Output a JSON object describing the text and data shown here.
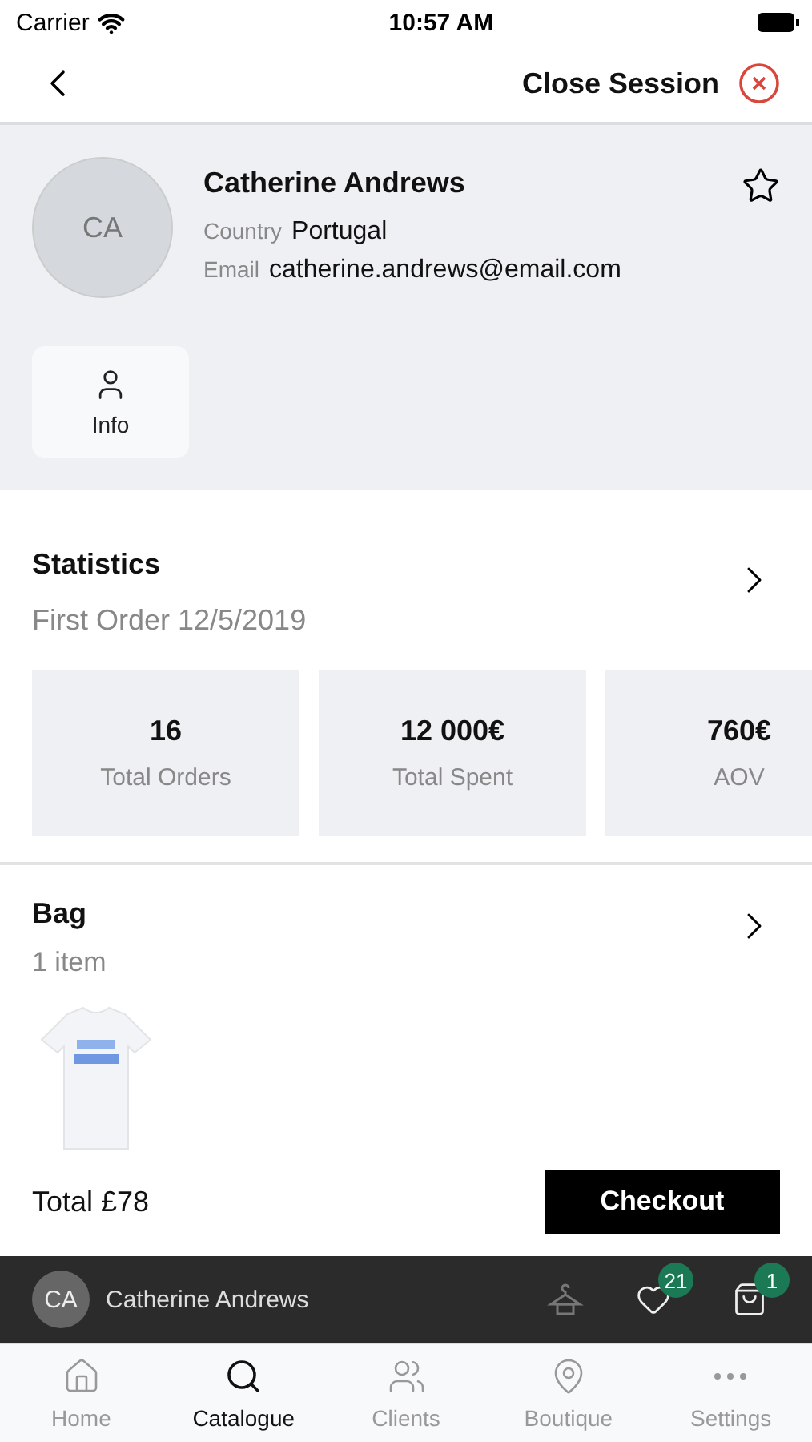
{
  "status_bar": {
    "carrier": "Carrier",
    "time": "10:57 AM"
  },
  "nav": {
    "action": "Close Session"
  },
  "client": {
    "initials": "CA",
    "name": "Catherine Andrews",
    "favorite": false,
    "fields": [
      {
        "label": "Country",
        "value": "Portugal"
      },
      {
        "label": "Email",
        "value": "catherine.andrews@email.com"
      }
    ],
    "info_button": "Info"
  },
  "statistics": {
    "title": "Statistics",
    "subtitle": "First Order 12/5/2019",
    "cards": [
      {
        "value": "16",
        "label": "Total Orders"
      },
      {
        "value": "12 000€",
        "label": "Total Spent"
      },
      {
        "value": "760€",
        "label": "AOV"
      }
    ]
  },
  "bag": {
    "title": "Bag",
    "subtitle": "1 item",
    "total": "Total £78",
    "checkout": "Checkout"
  },
  "session_bar": {
    "initials": "CA",
    "name": "Catherine Andrews",
    "wishlist_count": "21",
    "bag_count": "1"
  },
  "tabs": [
    {
      "label": "Home",
      "selected": false
    },
    {
      "label": "Catalogue",
      "selected": true
    },
    {
      "label": "Clients",
      "selected": false
    },
    {
      "label": "Boutique",
      "selected": false
    },
    {
      "label": "Settings",
      "selected": false
    }
  ]
}
